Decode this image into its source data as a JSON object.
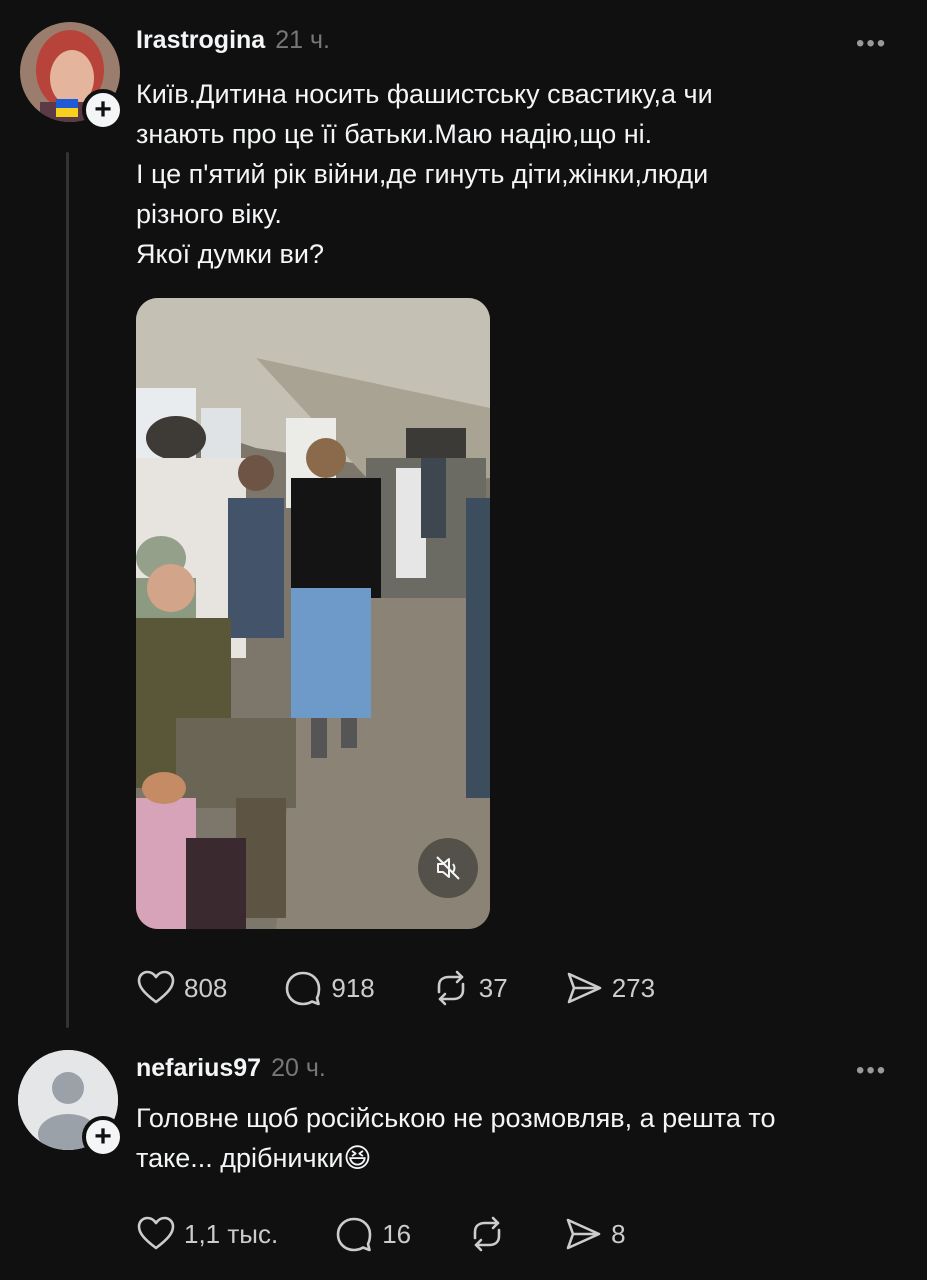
{
  "posts": [
    {
      "username": "Irastrogina",
      "time": "21 ч.",
      "text": "Київ.Дитина носить фашистську свастику,а чи\nзнають про це її батьки.Маю надію,що ні.\nІ це п'ятий рік війни,де гинуть діти,жінки,люди\nрізного віку.\nЯкої думки ви?",
      "likes": "808",
      "comments": "918",
      "reposts": "37",
      "shares": "273",
      "avatar_badge": "ukraine-flag"
    },
    {
      "username": "nefarius97",
      "time": "20 ч.",
      "text": "Головне щоб російською не розмовляв, а решта то\nтаке... дрібнички😆",
      "likes": "1,1 тыс.",
      "comments": "16",
      "shares": "8"
    }
  ],
  "icons": {
    "more": "more-dots-icon",
    "like": "heart-icon",
    "comment": "comment-bubble-icon",
    "repost": "repost-icon",
    "share": "send-icon",
    "follow": "plus-icon",
    "mute": "muted-speaker-icon"
  },
  "colors": {
    "background": "#101010",
    "text": "#f3f5f7",
    "muted": "#777777"
  }
}
